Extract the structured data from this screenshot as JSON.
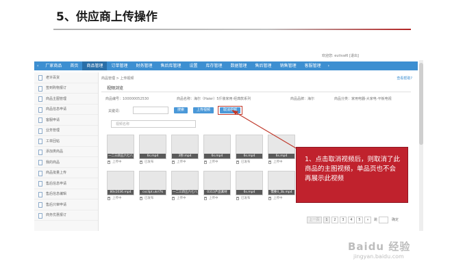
{
  "slide": {
    "title": "5、供应商上传操作"
  },
  "userbar": "欢迎您: eutival6 [退出]",
  "topnav": {
    "items": [
      "厂家商品",
      "首页",
      "商品管理",
      "订单管理",
      "财务管理",
      "售后库管理",
      "设置",
      "库存管理",
      "数据管理",
      "售后管理",
      "销售管理",
      "客服管理"
    ],
    "active_index": 2
  },
  "sidebar": {
    "items": [
      "老许百货",
      "签到购物报订",
      "商品主图管理",
      "商品信息申请",
      "客服申请",
      "业务管理",
      "工单回帖",
      "添加类商品",
      "我的商品",
      "商品批量上传",
      "售后信息申请",
      "售后信息编辑",
      "售后只审申请",
      "商务优惠报订"
    ]
  },
  "main": {
    "breadcrumb": "商品管理 > 上传视频",
    "help": "查看帮助?",
    "panel_title": "视频浏览",
    "info": {
      "product_no": "商品编号：100000052530",
      "product_name": "商品名称：海尔（Haier）5斤装家用·经典款系列",
      "brand": "商品品牌：海尔",
      "category": "商品分类：家用电器-大家电-平板电视"
    },
    "search_label": "关键词：",
    "buttons": {
      "search": "搜索",
      "upload": "上传视频",
      "cancel": "取消视频"
    },
    "url_placeholder": "视频名称"
  },
  "videos": {
    "row1": [
      {
        "name": "一二三四五六七八",
        "status": "上传中"
      },
      {
        "name": "6s.mp4",
        "status": "已发布"
      },
      {
        "name": "3秒.mp4",
        "status": "上传中"
      },
      {
        "name": "6s.mp4",
        "status": "上传中"
      },
      {
        "name": "6s.mp4",
        "status": "已发布"
      },
      {
        "name": "6s.mp4",
        "status": "上传中"
      }
    ],
    "row2": [
      {
        "name": "80s1036.mp4",
        "status": "上传中"
      },
      {
        "name": "cxcilpt.ukrl7k",
        "status": "已发布"
      },
      {
        "name": "一二三四五六七八",
        "status": "上传中"
      },
      {
        "name": "0313产品素材",
        "status": "上传中"
      },
      {
        "name": "6s.mp4",
        "status": "已发布"
      },
      {
        "name": "需要4_3b.mp4",
        "status": "上传中"
      }
    ]
  },
  "pagination": {
    "prev": "上一页",
    "pages": [
      "1",
      "2",
      "3",
      "4",
      "5"
    ],
    "next": "»",
    "jump_label": "跳",
    "confirm": "确定"
  },
  "callout": {
    "text": "1、点击取消视频后，则取消了此商品的主图视频，单品页也不会再展示此视频"
  },
  "watermark": {
    "main": "Baidu 经验",
    "sub": "jingyan.baidu.com"
  }
}
